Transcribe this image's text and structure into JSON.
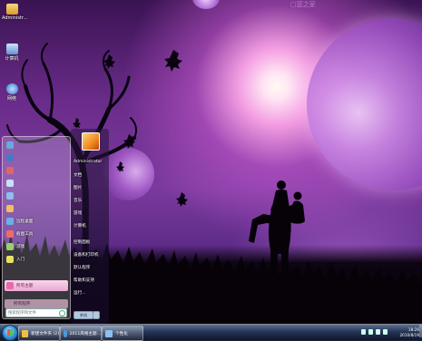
{
  "wallpaper": {
    "logo": "□蓝之家"
  },
  "desktop_icons": [
    {
      "label": "Administr...",
      "icon": "user-folder-icon",
      "color": "#e8b84a"
    },
    {
      "label": "计算机",
      "icon": "computer-icon",
      "color": "#7fb0e0"
    },
    {
      "label": "网络",
      "icon": "network-icon",
      "color": "#5fa0e8"
    }
  ],
  "start_menu": {
    "left_items": [
      {
        "label": "",
        "icon": "app-icon-1",
        "color": "#6aa8e0"
      },
      {
        "label": "",
        "icon": "app-icon-2",
        "color": "#4a78c8"
      },
      {
        "label": "",
        "icon": "app-icon-3",
        "color": "#e06666"
      },
      {
        "label": "",
        "icon": "app-icon-4",
        "color": "#c8e0f8"
      },
      {
        "label": "",
        "icon": "app-icon-5",
        "color": "#88c0f0"
      },
      {
        "label": "",
        "icon": "app-icon-6",
        "color": "#f0c060"
      },
      {
        "label": "远程桌面",
        "icon": "remote-desktop-icon",
        "color": "#6ab0e8"
      },
      {
        "label": "截图工具",
        "icon": "snipping-tool-icon",
        "color": "#f06a6a"
      },
      {
        "label": "游戏",
        "icon": "games-icon",
        "color": "#9ad06a"
      },
      {
        "label": "入门",
        "icon": "getting-started-icon",
        "color": "#e8e060"
      }
    ],
    "highlighted_item": {
      "label": "所有主题",
      "icon": "themes-icon",
      "color": "#e86aa8"
    },
    "all_programs": "所有程序",
    "search_placeholder": "搜索程序和文件",
    "right_items": [
      "Administrator",
      "文档",
      "图片",
      "音乐",
      "游戏",
      "计算机",
      "控制面板",
      "设备和打印机",
      "默认程序",
      "帮助和支持",
      "运行..."
    ],
    "shutdown_label": "关机"
  },
  "taskbar": {
    "buttons": [
      {
        "label": "新建文件夹 (2)",
        "icon": "folder-icon",
        "color": "#f0c040"
      },
      {
        "label": "2011风格主题...",
        "icon": "ie-icon",
        "color": "#4a9ae8"
      },
      {
        "label": "个性化",
        "icon": "personalize-icon",
        "color": "#88c0f0"
      }
    ],
    "clock_time": "18:26",
    "clock_date": "2010/8/19"
  }
}
